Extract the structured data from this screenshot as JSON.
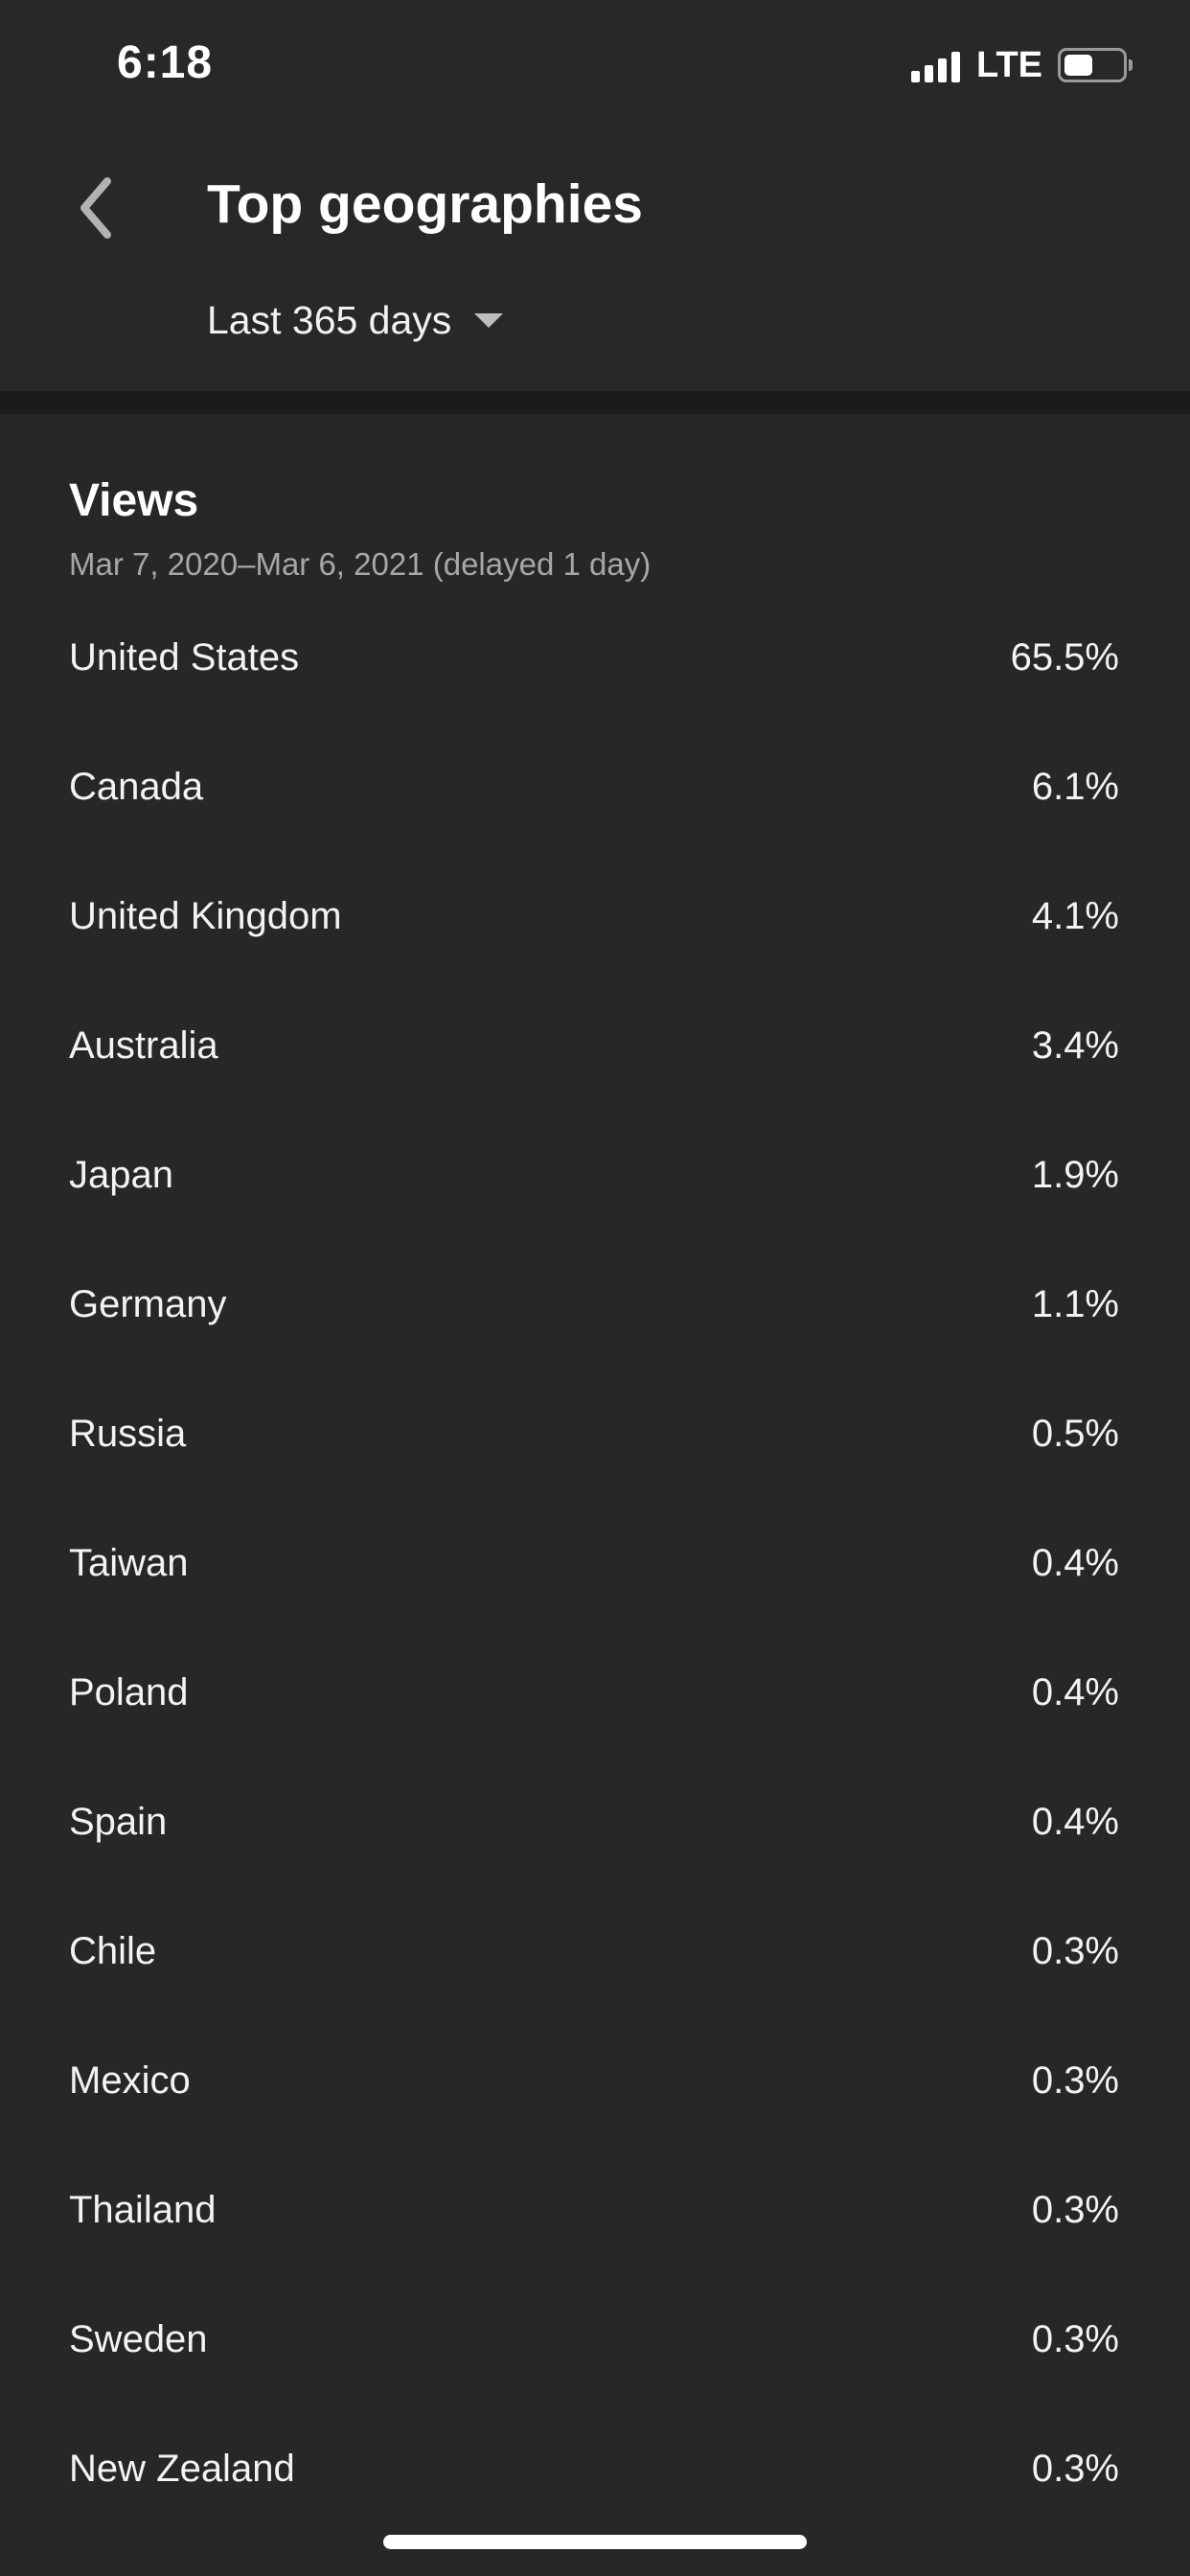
{
  "status_bar": {
    "time": "6:18",
    "network": "LTE",
    "battery_level": 0.5
  },
  "header": {
    "title": "Top geographies",
    "range_label": "Last 365 days",
    "icons": [
      "back-arrow-icon",
      "chevron-down-icon"
    ]
  },
  "section": {
    "title": "Views",
    "subtitle": "Mar 7, 2020–Mar 6, 2021 (delayed 1 day)"
  },
  "geographies": [
    {
      "name": "United States",
      "value": "65.5%"
    },
    {
      "name": "Canada",
      "value": "6.1%"
    },
    {
      "name": "United Kingdom",
      "value": "4.1%"
    },
    {
      "name": "Australia",
      "value": "3.4%"
    },
    {
      "name": "Japan",
      "value": "1.9%"
    },
    {
      "name": "Germany",
      "value": "1.1%"
    },
    {
      "name": "Russia",
      "value": "0.5%"
    },
    {
      "name": "Taiwan",
      "value": "0.4%"
    },
    {
      "name": "Poland",
      "value": "0.4%"
    },
    {
      "name": "Spain",
      "value": "0.4%"
    },
    {
      "name": "Chile",
      "value": "0.3%"
    },
    {
      "name": "Mexico",
      "value": "0.3%"
    },
    {
      "name": "Thailand",
      "value": "0.3%"
    },
    {
      "name": "Sweden",
      "value": "0.3%"
    },
    {
      "name": "New Zealand",
      "value": "0.3%"
    }
  ],
  "colors": {
    "background": "#272727",
    "separator": "#1b1b1b",
    "primary_text": "#ffffff",
    "secondary_text": "#a7a7a7"
  }
}
